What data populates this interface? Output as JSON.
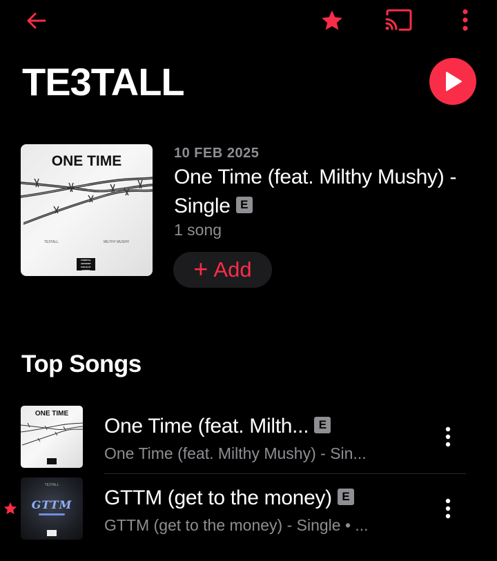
{
  "accent_color": "#fa2d48",
  "artist": {
    "name": "TE3TALL"
  },
  "latest_release": {
    "date": "10 FEB 2025",
    "title": "One Time (feat. Milthy Mushy) - Single",
    "explicit_badge": "E",
    "song_count": "1 song",
    "add_label": "Add",
    "add_icon": "+",
    "artwork": {
      "title": "ONE TIME",
      "artist_credit": "TE3TALL",
      "feature_credit": "MILTHY MUSHY",
      "advisory": "PARENTAL ADVISORY EXPLICIT CONTENT"
    }
  },
  "top_songs": {
    "heading": "Top Songs",
    "items": [
      {
        "title": "One Time (feat. Milth...",
        "explicit_badge": "E",
        "subtitle": "One Time (feat. Milthy Mushy) - Sin...",
        "artwork_title": "ONE TIME",
        "favorited": false
      },
      {
        "title": "GTTM (get to the money)",
        "explicit_badge": "E",
        "subtitle": "GTTM (get to the money) - Single • ...",
        "artwork_title": "GTTM",
        "artwork_artist": "TE3TALL",
        "favorited": true
      }
    ]
  },
  "icons": {
    "back": "arrow-left-icon",
    "favorite": "star-icon",
    "cast": "cast-icon",
    "more": "more-vertical-icon",
    "play": "play-icon"
  }
}
